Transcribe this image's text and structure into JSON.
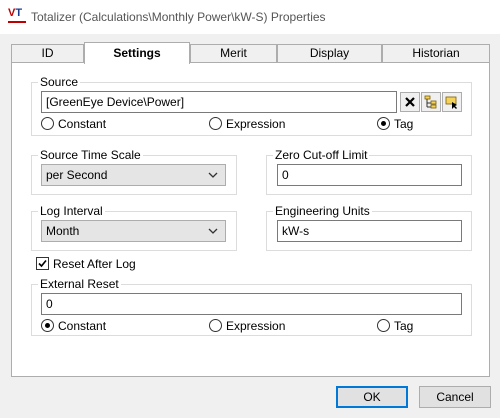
{
  "window": {
    "logo_text": "VT",
    "title": "Totalizer (Calculations\\Monthly Power\\kW-S) Properties"
  },
  "tabs": [
    {
      "label": "ID",
      "active": false
    },
    {
      "label": "Settings",
      "active": true
    },
    {
      "label": "Merit",
      "active": false
    },
    {
      "label": "Display",
      "active": false
    },
    {
      "label": "Historian",
      "active": false
    }
  ],
  "source": {
    "label": "Source",
    "value": "[GreenEye Device\\Power]",
    "options": [
      "Constant",
      "Expression",
      "Tag"
    ],
    "selected": "Tag",
    "icons": [
      "clear-icon",
      "tag-browser-icon",
      "select-tag-icon"
    ]
  },
  "source_time_scale": {
    "label": "Source Time Scale",
    "value": "per Second"
  },
  "zero_cutoff": {
    "label": "Zero Cut-off Limit",
    "value": "0"
  },
  "log_interval": {
    "label": "Log Interval",
    "value": "Month"
  },
  "engineering_units": {
    "label": "Engineering Units",
    "value": "kW-s"
  },
  "reset_after_log": {
    "label": "Reset After Log",
    "checked": true
  },
  "external_reset": {
    "label": "External Reset",
    "value": "0",
    "options": [
      "Constant",
      "Expression",
      "Tag"
    ],
    "selected": "Constant"
  },
  "buttons": {
    "ok": "OK",
    "cancel": "Cancel"
  },
  "colors": {
    "accent": "#0078d7",
    "logo_red": "#c00000",
    "logo_blue": "#1a3d8f"
  }
}
